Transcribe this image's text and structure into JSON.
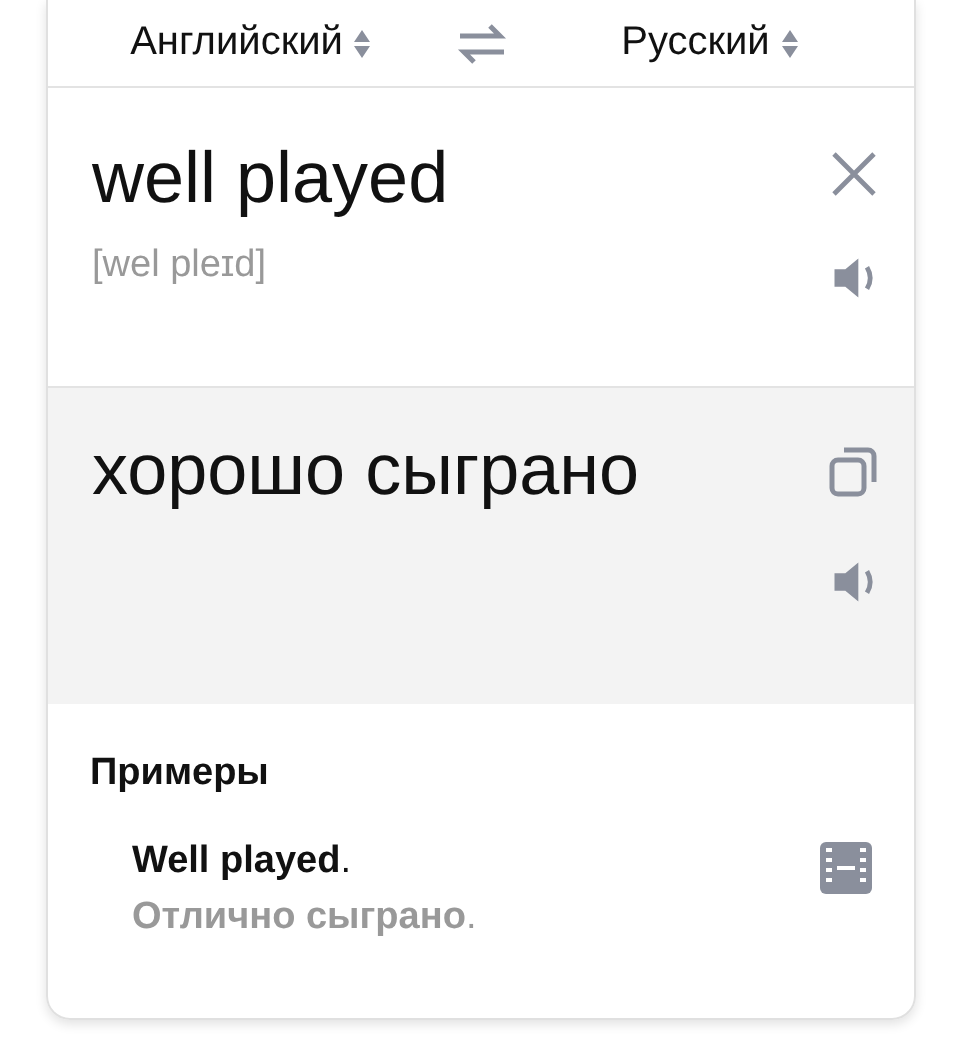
{
  "languages": {
    "source": "Английский",
    "target": "Русский"
  },
  "source": {
    "text": "well played",
    "transcription": "[wel pleɪd]"
  },
  "translation": {
    "text": "хорошо сыграно"
  },
  "examples": {
    "title": "Примеры",
    "items": [
      {
        "original": "**Well played**.",
        "translation": "**Отлично сыграно**."
      }
    ]
  }
}
